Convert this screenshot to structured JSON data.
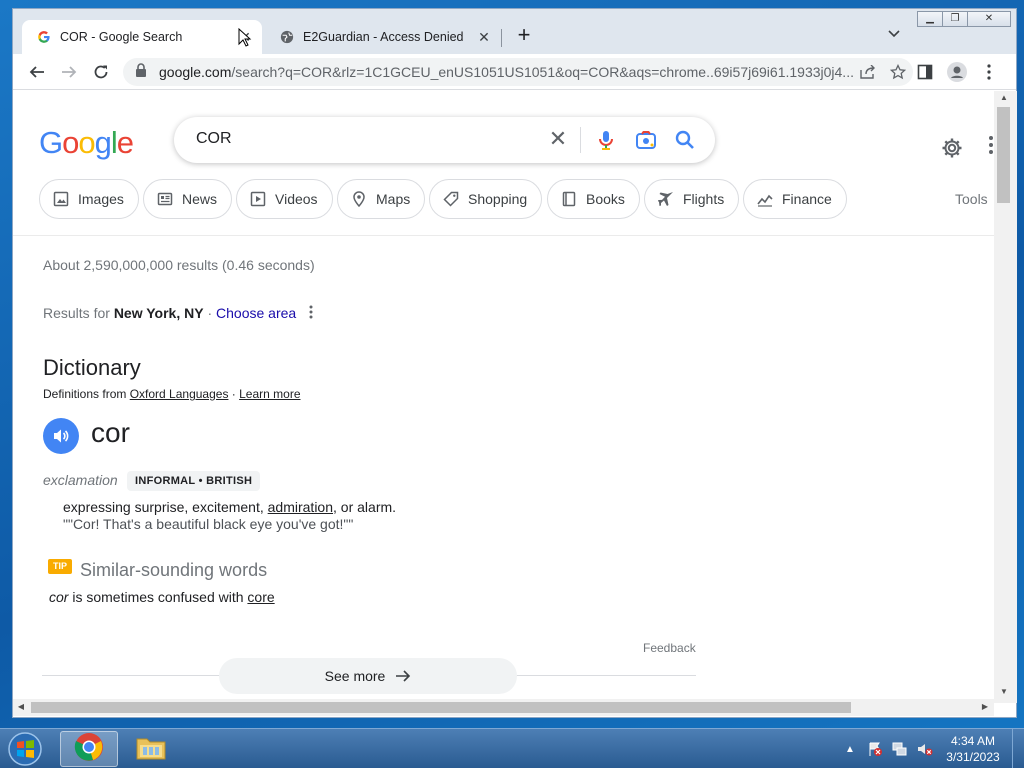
{
  "browser": {
    "tabs": [
      {
        "title": "COR - Google Search",
        "active": true
      },
      {
        "title": "E2Guardian - Access Denied",
        "active": false
      }
    ],
    "url_host": "google.com",
    "url_rest": "/search?q=COR&rlz=1C1GCEU_enUS1051US1051&oq=COR&aqs=chrome..69i57j69i61.1933j0j4...",
    "new_tab_label": "+"
  },
  "search": {
    "query": "COR",
    "chips": [
      "Images",
      "News",
      "Videos",
      "Maps",
      "Shopping",
      "Books",
      "Flights",
      "Finance"
    ],
    "tools_label": "Tools",
    "stats": "About 2,590,000,000 results (0.46 seconds)",
    "results_for_prefix": "Results for ",
    "location": "New York, NY",
    "location_sep": " · ",
    "choose_area": "Choose area"
  },
  "dictionary": {
    "title": "Dictionary",
    "definitions_from": "Definitions from ",
    "source": "Oxford Languages",
    "source_sep": " · ",
    "learn_more": "Learn more",
    "word": "cor",
    "part_of_speech": "exclamation",
    "tags": "INFORMAL • BRITISH",
    "definition_a": "expressing surprise, excitement, ",
    "definition_link": "admiration",
    "definition_b": ", or alarm.",
    "example": "\"\"Cor! That's a beautiful black eye you've got!\"\"",
    "tip_label": "TIP",
    "similar_title": "Similar-sounding words",
    "similar_word": "cor",
    "similar_mid": " is sometimes confused with ",
    "similar_target": "core",
    "feedback": "Feedback",
    "see_more": "See more"
  },
  "taskbar": {
    "time": "4:34 AM",
    "date": "3/31/2023"
  },
  "colors": {
    "google_blue": "#4285f4",
    "google_red": "#ea4335",
    "google_yellow": "#fbbc05",
    "google_green": "#34a853",
    "link": "#1a0dab",
    "tip": "#f9ab00"
  }
}
